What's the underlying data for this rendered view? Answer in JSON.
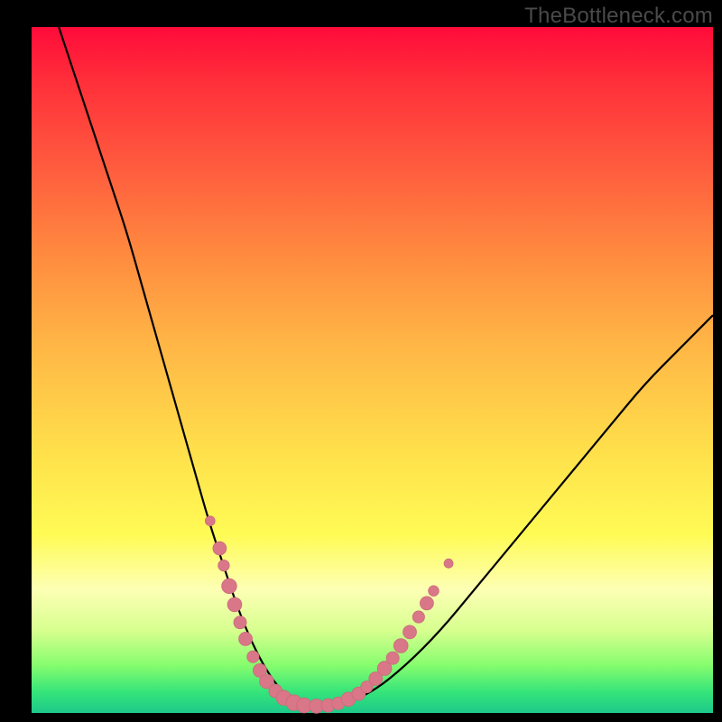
{
  "watermark": "TheBottleneck.com",
  "colors": {
    "background_frame": "#000000",
    "curve_stroke": "#000000",
    "marker_fill": "#d97788",
    "marker_stroke": "#c96a7b"
  },
  "chart_data": {
    "type": "line",
    "title": "",
    "xlabel": "",
    "ylabel": "",
    "xlim": [
      0,
      100
    ],
    "ylim": [
      0,
      100
    ],
    "grid": false,
    "legend": false,
    "series": [
      {
        "name": "bottleneck-curve",
        "x": [
          4,
          6,
          8,
          10,
          12,
          14,
          16,
          18,
          20,
          22,
          24,
          26,
          28,
          30,
          32,
          34,
          36,
          38,
          40,
          45,
          50,
          55,
          60,
          65,
          70,
          75,
          80,
          85,
          90,
          95,
          100
        ],
        "y": [
          100,
          94,
          88,
          82,
          76,
          70,
          63,
          56,
          49,
          42,
          35,
          28,
          22,
          16,
          11,
          7,
          4,
          2,
          1,
          1,
          3,
          7,
          12,
          18,
          24,
          30,
          36,
          42,
          48,
          53,
          58
        ]
      }
    ],
    "markers": {
      "name": "highlight-band",
      "points": [
        {
          "x": 26.2,
          "y": 28.0,
          "r": 1.3
        },
        {
          "x": 27.6,
          "y": 24.0,
          "r": 1.8
        },
        {
          "x": 28.2,
          "y": 21.5,
          "r": 1.5
        },
        {
          "x": 29.0,
          "y": 18.5,
          "r": 2.0
        },
        {
          "x": 29.8,
          "y": 15.8,
          "r": 1.9
        },
        {
          "x": 30.6,
          "y": 13.2,
          "r": 1.7
        },
        {
          "x": 31.4,
          "y": 10.8,
          "r": 1.8
        },
        {
          "x": 32.5,
          "y": 8.2,
          "r": 1.6
        },
        {
          "x": 33.5,
          "y": 6.2,
          "r": 1.8
        },
        {
          "x": 34.5,
          "y": 4.6,
          "r": 1.9
        },
        {
          "x": 35.8,
          "y": 3.2,
          "r": 1.8
        },
        {
          "x": 37.0,
          "y": 2.2,
          "r": 2.0
        },
        {
          "x": 38.5,
          "y": 1.5,
          "r": 2.1
        },
        {
          "x": 40.0,
          "y": 1.1,
          "r": 2.0
        },
        {
          "x": 41.8,
          "y": 1.0,
          "r": 1.9
        },
        {
          "x": 43.5,
          "y": 1.1,
          "r": 1.8
        },
        {
          "x": 45.0,
          "y": 1.4,
          "r": 1.7
        },
        {
          "x": 46.5,
          "y": 2.0,
          "r": 1.9
        },
        {
          "x": 48.0,
          "y": 2.8,
          "r": 1.8
        },
        {
          "x": 49.2,
          "y": 3.8,
          "r": 1.6
        },
        {
          "x": 50.5,
          "y": 5.0,
          "r": 1.8
        },
        {
          "x": 51.8,
          "y": 6.5,
          "r": 1.9
        },
        {
          "x": 53.0,
          "y": 8.0,
          "r": 1.7
        },
        {
          "x": 54.2,
          "y": 9.8,
          "r": 1.9
        },
        {
          "x": 55.5,
          "y": 11.8,
          "r": 1.8
        },
        {
          "x": 56.8,
          "y": 14.0,
          "r": 1.6
        },
        {
          "x": 58.0,
          "y": 16.0,
          "r": 1.8
        },
        {
          "x": 59.0,
          "y": 17.8,
          "r": 1.4
        },
        {
          "x": 61.2,
          "y": 21.8,
          "r": 1.2
        }
      ]
    }
  }
}
